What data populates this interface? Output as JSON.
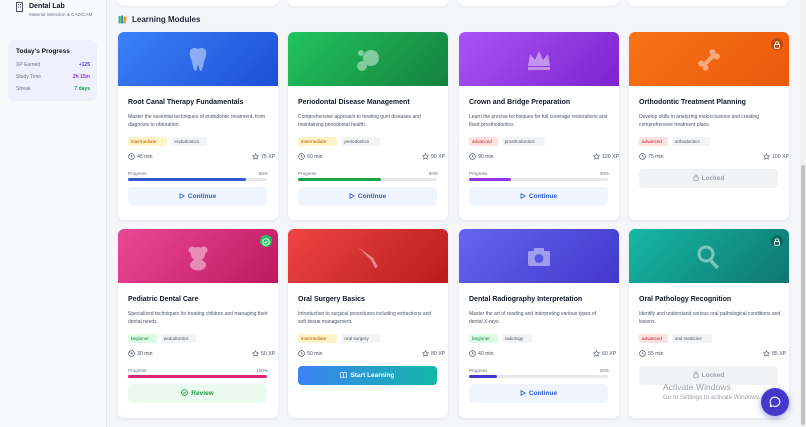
{
  "sidebar": {
    "app_title": "Dental Lab",
    "app_subtitle": "Material Selection & CAD/CAM",
    "progress": {
      "title": "Today's Progress",
      "rows": [
        {
          "label": "XP Earned",
          "value": "+125",
          "color": "#4f46e5"
        },
        {
          "label": "Study Time",
          "value": "2h 15m",
          "color": "#9333ea"
        },
        {
          "label": "Streak",
          "value": "7 days",
          "color": "#16a34a"
        }
      ]
    }
  },
  "main": {
    "section_title": "Learning Modules",
    "progress_label": "Progress",
    "modules": [
      {
        "title": "Root Canal Therapy Fundamentals",
        "desc": "Master the essential techniques of endodontic treatment, from diagnosis to obturation.",
        "level": "intermediate",
        "topic": "endodontics",
        "duration": "45 min",
        "xp": "75 XP",
        "progress": 85,
        "progress_text": "85%",
        "action": "Continue",
        "state": "continue",
        "icon": "tooth-icon",
        "color": "#2563eb"
      },
      {
        "title": "Periodontal Disease Management",
        "desc": "Comprehensive approach to treating gum diseases and maintaining periodontal health.",
        "level": "intermediate",
        "topic": "periodontics",
        "duration": "60 min",
        "xp": "90 XP",
        "progress": 60,
        "progress_text": "60%",
        "action": "Continue",
        "state": "continue",
        "icon": "bubbles-icon",
        "color": "#16a34a"
      },
      {
        "title": "Crown and Bridge Preparation",
        "desc": "Learn the precise techniques for full coverage restorations and fixed prosthodontics.",
        "level": "advanced",
        "topic": "prosthodontics",
        "duration": "90 min",
        "xp": "120 XP",
        "progress": 30,
        "progress_text": "30%",
        "action": "Continue",
        "state": "continue",
        "icon": "crown-icon",
        "color": "#9333ea"
      },
      {
        "title": "Orthodontic Treatment Planning",
        "desc": "Develop skills in analyzing malocclusions and creating comprehensive treatment plans.",
        "level": "advanced",
        "topic": "orthodontics",
        "duration": "75 min",
        "xp": "100 XP",
        "progress": null,
        "progress_text": "",
        "action": "Locked",
        "state": "locked",
        "icon": "bone-icon",
        "color": "#ea580c"
      },
      {
        "title": "Pediatric Dental Care",
        "desc": "Specialized techniques for treating children and managing their dental needs.",
        "level": "beginner",
        "topic": "pedodontics",
        "duration": "30 min",
        "xp": "50 XP",
        "progress": 100,
        "progress_text": "100%",
        "action": "Review",
        "state": "review",
        "icon": "teddy-bear-icon",
        "color": "#db2777"
      },
      {
        "title": "Oral Surgery Basics",
        "desc": "Introduction to surgical procedures including extractions and soft tissue management.",
        "level": "intermediate",
        "topic": "oral surgery",
        "duration": "50 min",
        "xp": "80 XP",
        "progress": null,
        "progress_text": "",
        "action": "Start Learning",
        "state": "start",
        "icon": "scalpel-icon",
        "color": "#dc2626"
      },
      {
        "title": "Dental Radiography Interpretation",
        "desc": "Master the art of reading and interpreting various types of dental X-rays.",
        "level": "beginner",
        "topic": "radiology",
        "duration": "40 min",
        "xp": "60 XP",
        "progress": 20,
        "progress_text": "20%",
        "action": "Continue",
        "state": "continue",
        "icon": "camera-icon",
        "color": "#4f46e5"
      },
      {
        "title": "Oral Pathology Recognition",
        "desc": "Identify and understand various oral pathological conditions and lesions.",
        "level": "advanced",
        "topic": "oral medicine",
        "duration": "55 min",
        "xp": "85 XP",
        "progress": null,
        "progress_text": "",
        "action": "Locked",
        "state": "locked",
        "icon": "magnifier-icon",
        "color": "#0d9488"
      }
    ]
  },
  "overlay": {
    "watermark_title": "Activate Windows",
    "watermark_sub": "Go to Settings to activate Windows."
  }
}
